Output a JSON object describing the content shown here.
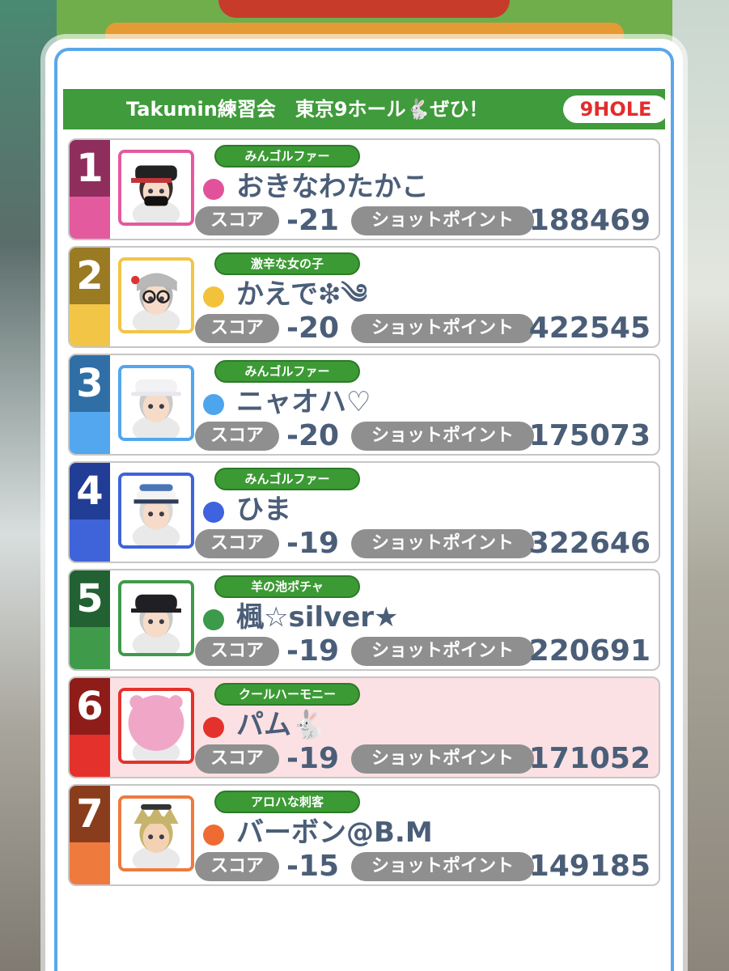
{
  "header": {
    "title": "Takumin練習会　東京9ホール🐇ぜひ！",
    "hole_badge": "9HOLE"
  },
  "labels": {
    "score": "スコア",
    "shot_points": "ショットポイント"
  },
  "players": [
    {
      "rank": "1",
      "title": "みんゴルファー",
      "name": "おきなわたかこ",
      "score": "-21",
      "shot_points": "188469",
      "rank_color": "#e45a9e",
      "rank_dark": "#8f2d5c",
      "dot_color": "#e2529b",
      "avatar": "black-cap-avatar-icon",
      "highlight": false
    },
    {
      "rank": "2",
      "title": "激辛な女の子",
      "name": "かえで❇︎༄",
      "score": "-20",
      "shot_points": "422545",
      "rank_color": "#f3c546",
      "rank_dark": "#9a7a23",
      "dot_color": "#f3c23b",
      "avatar": "gray-hair-glasses-avatar-icon",
      "highlight": false
    },
    {
      "rank": "3",
      "title": "みんゴルファー",
      "name": "ニャオハ♡",
      "score": "-20",
      "shot_points": "175073",
      "rank_color": "#52a7ee",
      "rank_dark": "#2f6fa6",
      "dot_color": "#4da5ee",
      "avatar": "white-cap-avatar-icon",
      "highlight": false
    },
    {
      "rank": "4",
      "title": "みんゴルファー",
      "name": "ひま",
      "score": "-19",
      "shot_points": "322646",
      "rank_color": "#3f63d9",
      "rank_dark": "#213d95",
      "dot_color": "#3f62de",
      "avatar": "goggles-cap-avatar-icon",
      "highlight": false
    },
    {
      "rank": "5",
      "title": "羊の池ポチャ",
      "name": "楓☆silver★",
      "score": "-19",
      "shot_points": "220691",
      "rank_color": "#3f9b4a",
      "rank_dark": "#226131",
      "dot_color": "#3c9a4b",
      "avatar": "black-cap-silver-hair-avatar-icon",
      "highlight": false
    },
    {
      "rank": "6",
      "title": "クールハーモニー",
      "name": "パム🐇",
      "score": "-19",
      "shot_points": "171052",
      "rank_color": "#e5312b",
      "rank_dark": "#8e1c18",
      "dot_color": "#e5312b",
      "avatar": "pink-bear-hood-avatar-icon",
      "highlight": true
    },
    {
      "rank": "7",
      "title": "アロハな刺客",
      "name": "バーボン@B.M",
      "score": "-15",
      "shot_points": "149185",
      "rank_color": "#ee7a3e",
      "rank_dark": "#8a3d1c",
      "dot_color": "#ee6c33",
      "avatar": "blonde-sunglasses-avatar-icon",
      "highlight": false
    }
  ]
}
